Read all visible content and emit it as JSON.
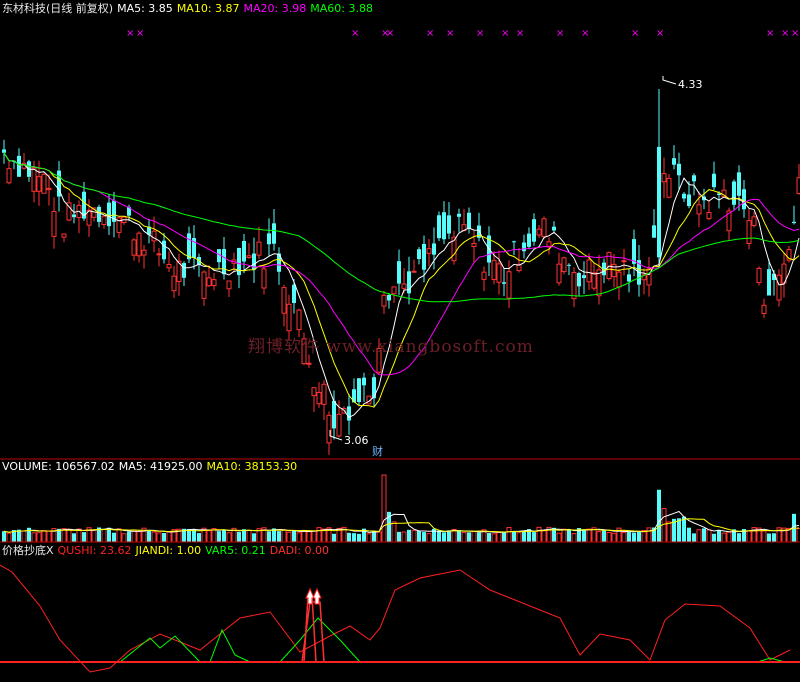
{
  "colors": {
    "up": "#ff3232",
    "down": "#54fcfc",
    "ma5": "#ffffff",
    "ma10": "#ffff00",
    "ma20": "#ff00ff",
    "ma60": "#00ff00",
    "divider": "#c00000",
    "qushi": "#ff2020",
    "jiandi": "#ffff00",
    "var5": "#00ff00",
    "dadi": "#ff3030",
    "star": "#ff00ff"
  },
  "price_panel": {
    "stock": "东材科技(日线 前复权)",
    "ma5_label": "MA5: 3.85",
    "ma10_label": "MA10: 3.87",
    "ma20_label": "MA20: 3.98",
    "ma60_label": "MA60: 3.88",
    "high_label": "4.33",
    "low_label": "3.06",
    "cai_label": "财"
  },
  "volume_panel": {
    "volume_label": "VOLUME: 106567.02",
    "ma5_label": "MA5: 41925.00",
    "ma10_label": "MA10: 38153.30"
  },
  "indicator_panel": {
    "name": "价格抄底X",
    "qushi_label": "QUSHI: 23.62",
    "jiandi_label": "JIANDI: 1.00",
    "var5_label": "VAR5: 0.21",
    "dadi_label": "DADI: 0.00"
  },
  "watermark": "翔博软件 www.xiangbosoft.com",
  "chart_data": {
    "type": "candlestick",
    "count": 160,
    "price_range": [
      3.0,
      4.58
    ],
    "high": 4.33,
    "low": 3.06,
    "close_path": [
      [
        0,
        4.1
      ],
      [
        8,
        4.0
      ],
      [
        12,
        3.85
      ],
      [
        16,
        3.9
      ],
      [
        22,
        3.88
      ],
      [
        28,
        3.8
      ],
      [
        34,
        3.68
      ],
      [
        40,
        3.66
      ],
      [
        46,
        3.7
      ],
      [
        50,
        3.72
      ],
      [
        54,
        3.75
      ],
      [
        58,
        3.55
      ],
      [
        62,
        3.3
      ],
      [
        66,
        3.15
      ],
      [
        70,
        3.2
      ],
      [
        74,
        3.26
      ],
      [
        76,
        3.62
      ],
      [
        80,
        3.62
      ],
      [
        84,
        3.68
      ],
      [
        88,
        3.78
      ],
      [
        92,
        3.82
      ],
      [
        96,
        3.72
      ],
      [
        100,
        3.66
      ],
      [
        104,
        3.78
      ],
      [
        108,
        3.82
      ],
      [
        112,
        3.72
      ],
      [
        116,
        3.65
      ],
      [
        120,
        3.7
      ],
      [
        124,
        3.68
      ],
      [
        128,
        3.62
      ],
      [
        132,
        4.05
      ],
      [
        136,
        3.96
      ],
      [
        140,
        3.92
      ],
      [
        144,
        3.95
      ],
      [
        148,
        3.9
      ],
      [
        150,
        3.82
      ],
      [
        152,
        3.6
      ],
      [
        154,
        3.6
      ],
      [
        157,
        3.75
      ],
      [
        159,
        4.0
      ]
    ],
    "star_positions": [
      25,
      27,
      70,
      76,
      77,
      85,
      89,
      95,
      100,
      103,
      111,
      116,
      126,
      131,
      153,
      156,
      158
    ]
  }
}
